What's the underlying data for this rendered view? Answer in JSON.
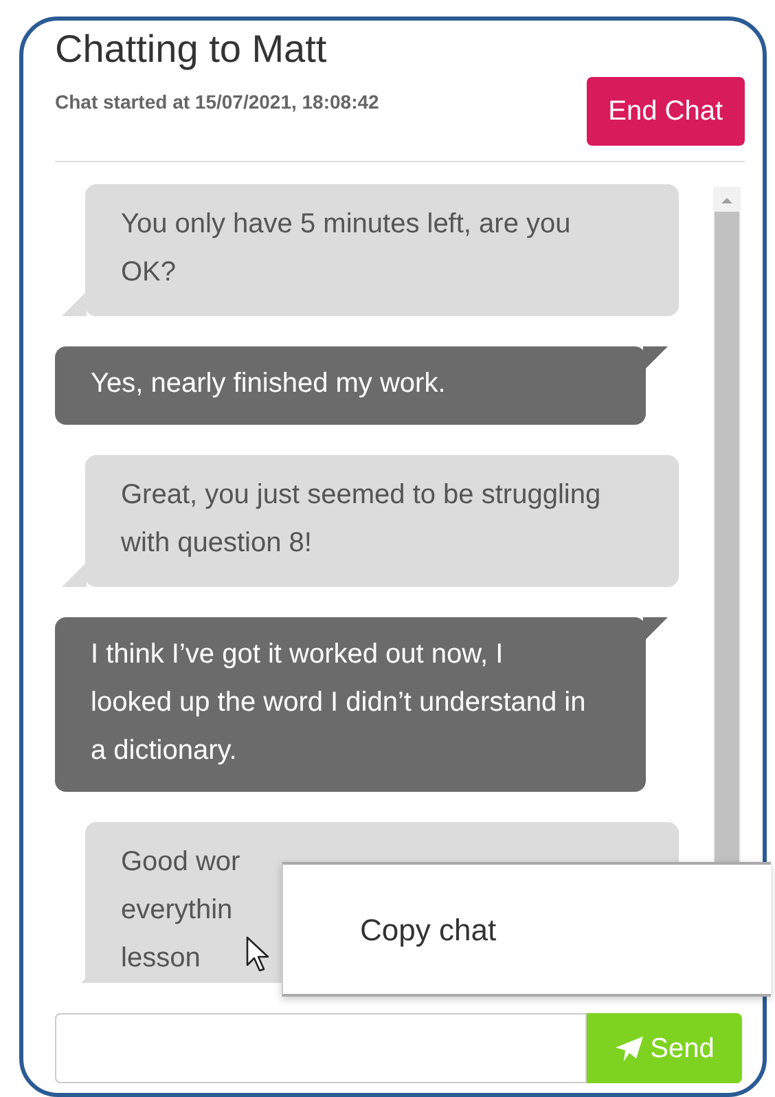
{
  "header": {
    "title": "Chatting to Matt",
    "started": "Chat started at 15/07/2021, 18:08:42",
    "end_button": "End Chat"
  },
  "messages": [
    {
      "kind": "received",
      "text": "You only have 5 minutes left, are you OK?"
    },
    {
      "kind": "sent",
      "text": "Yes, nearly finished my work."
    },
    {
      "kind": "received",
      "text": "Great, you just seemed to be struggling with question 8!"
    },
    {
      "kind": "sent",
      "text": "I think I’ve got it worked out now, I looked up the word I didn’t understand in a dictionary."
    },
    {
      "kind": "received",
      "lines": [
        "Good wor",
        "everythin",
        "lesson"
      ]
    }
  ],
  "composer": {
    "send_button": "Send"
  },
  "context_menu": {
    "items": [
      "Copy chat"
    ]
  }
}
